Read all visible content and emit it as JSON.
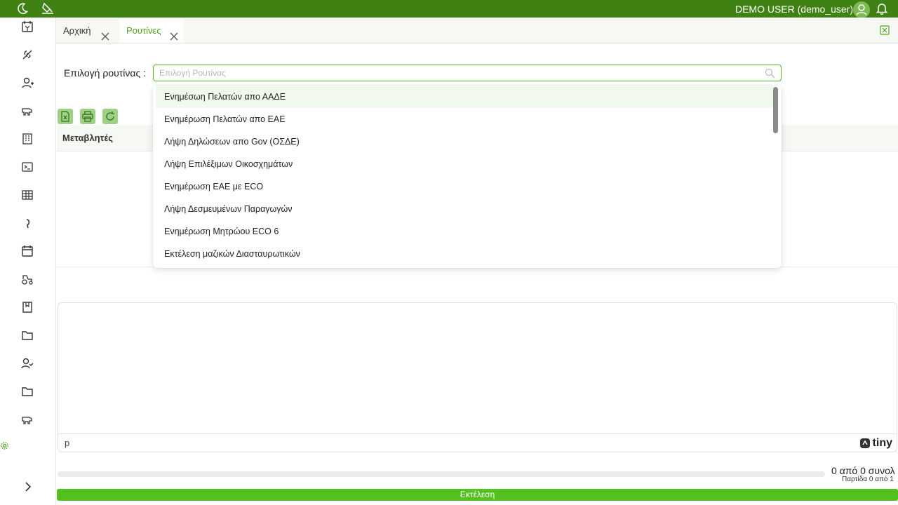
{
  "topbar": {
    "user_label": "DEMO USER (demo_user)",
    "icons": [
      "moon-icon",
      "paint-icon",
      "avatar-icon",
      "bell-icon"
    ],
    "color": "#3f8113"
  },
  "sidebar": {
    "items": [
      "calendar-yen-icon",
      "plant-icon",
      "user-plus-icon",
      "cow-icon",
      "building-icon",
      "terminal-icon",
      "table-icon",
      "leaf-icon",
      "calendar-icon",
      "tractor-icon",
      "book-icon",
      "folder-icon",
      "users-icon",
      "folder-icon",
      "cow-icon"
    ],
    "settings_icon": "gear-icon",
    "expand_icon": "chevron-right-icon"
  },
  "tabs": [
    {
      "label": "Αρχική",
      "active": false
    },
    {
      "label": "Ρουτίνες",
      "active": true
    }
  ],
  "routine": {
    "label": "Επιλογή ρουτίνας :",
    "placeholder": "Επιλογή Ρουτίνας"
  },
  "dropdown": {
    "options": [
      "Ενημέσωη Πελατών απο ΑΑΔΕ",
      "Ενημέρωση Πελατών απο ΕΑΕ",
      "Λήψη Δηλώσεων απο Gov (ΟΣΔΕ)",
      "Λήψη Επιλέξιμων Οικοσχημάτων",
      "Ενημέρωση ΕΑΕ με ECO",
      "Λήψη Δεσμευμένων Παραγωγών",
      "Ενημέρωση Μητρώου ECO 6",
      "Εκτέλεση μαζικών Διασταυρωτικών"
    ],
    "highlighted_index": 0
  },
  "toolbar": {
    "buttons": [
      "excel-export-icon",
      "print-icon",
      "refresh-icon"
    ]
  },
  "grid": {
    "header": "Μεταβλητές"
  },
  "editor": {
    "path": "p",
    "brand": "tiny"
  },
  "footer": {
    "counter": "0 από 0 συνολ",
    "page_info": "Παρτίδα 0 από 1",
    "run_label": "Εκτέλεση"
  },
  "colors": {
    "accent": "#52c01e",
    "active_tab_text": "#4fa21c",
    "toolbar_button": "#9ed088"
  }
}
